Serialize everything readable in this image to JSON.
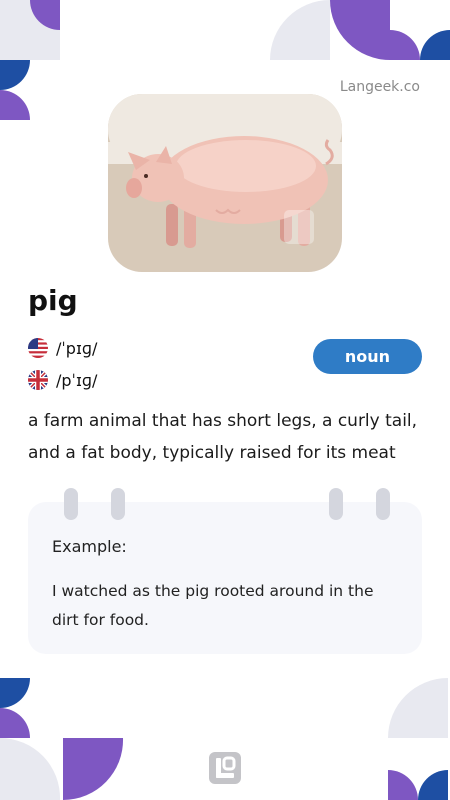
{
  "brand": "Langeek.co",
  "image": {
    "alt": "pig",
    "watermark": "Langeek"
  },
  "word": "pig",
  "pronunciations": [
    {
      "region": "US",
      "flag": "us-flag-icon",
      "ipa": "/ˈpɪɡ/"
    },
    {
      "region": "UK",
      "flag": "uk-flag-icon",
      "ipa": "/pˈɪɡ/"
    }
  ],
  "part_of_speech": "noun",
  "definition": "a farm animal that has short legs, a curly tail, and a fat body, typically raised for its meat",
  "example": {
    "title": "Example:",
    "sentence": "I watched as the pig rooted around in the dirt for food."
  },
  "colors": {
    "accent_purple": "#7e57c2",
    "accent_blue": "#1e4fa3",
    "badge_blue": "#2f7cc6",
    "light_gray": "#e8e9f0"
  },
  "footer": {
    "logo": "langeek-logo-icon"
  }
}
